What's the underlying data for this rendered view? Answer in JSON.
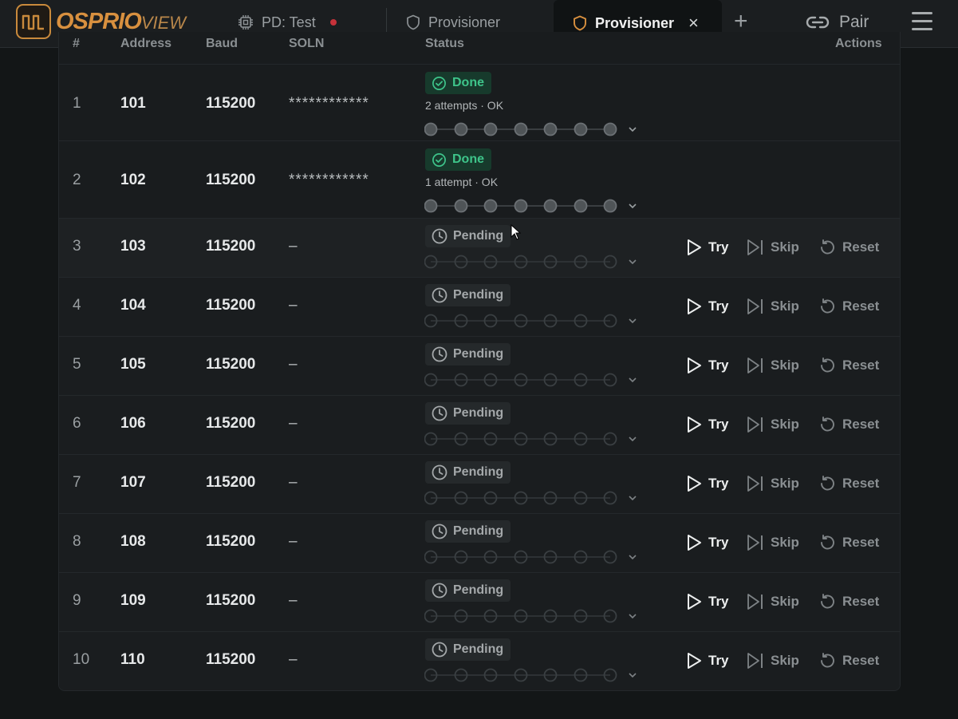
{
  "app": {
    "logo_main": "OSPRIO",
    "logo_sub": "VIEW"
  },
  "tabs": [
    {
      "label": "PD: Test",
      "icon": "chip-icon",
      "status_color": "#c6323a"
    },
    {
      "label": "Provisioner",
      "icon": "shield-icon"
    },
    {
      "label": "Provisioner",
      "icon": "shield-icon",
      "active": true,
      "close": "×"
    }
  ],
  "toolbar": {
    "add_tab": "+",
    "pair_label": "Pair"
  },
  "table": {
    "columns": [
      "#",
      "Address",
      "Baud",
      "SOLN",
      "Status",
      "Actions"
    ],
    "rows": [
      {
        "num": "1",
        "address": "101",
        "baud": "115200",
        "secret": "************",
        "status": "Done",
        "attempts": "2 attempts · OK",
        "steps_done": 7,
        "steps_total": 7
      },
      {
        "num": "2",
        "address": "102",
        "baud": "115200",
        "secret": "************",
        "status": "Done",
        "attempts": "1 attempt · OK",
        "steps_done": 7,
        "steps_total": 7
      },
      {
        "num": "3",
        "address": "103",
        "baud": "115200",
        "secret": "–",
        "status": "Pending",
        "steps_done": 0,
        "steps_total": 7,
        "actions": [
          "Try",
          "Skip",
          "Reset"
        ]
      },
      {
        "num": "4",
        "address": "104",
        "baud": "115200",
        "secret": "–",
        "status": "Pending",
        "steps_done": 0,
        "steps_total": 7,
        "actions": [
          "Try",
          "Skip",
          "Reset"
        ]
      },
      {
        "num": "5",
        "address": "105",
        "baud": "115200",
        "secret": "–",
        "status": "Pending",
        "steps_done": 0,
        "steps_total": 7,
        "actions": [
          "Try",
          "Skip",
          "Reset"
        ]
      },
      {
        "num": "6",
        "address": "106",
        "baud": "115200",
        "secret": "–",
        "status": "Pending",
        "steps_done": 0,
        "steps_total": 7,
        "actions": [
          "Try",
          "Skip",
          "Reset"
        ]
      },
      {
        "num": "7",
        "address": "107",
        "baud": "115200",
        "secret": "–",
        "status": "Pending",
        "steps_done": 0,
        "steps_total": 7,
        "actions": [
          "Try",
          "Skip",
          "Reset"
        ]
      },
      {
        "num": "8",
        "address": "108",
        "baud": "115200",
        "secret": "–",
        "status": "Pending",
        "steps_done": 0,
        "steps_total": 7,
        "actions": [
          "Try",
          "Skip",
          "Reset"
        ]
      },
      {
        "num": "9",
        "address": "109",
        "baud": "115200",
        "secret": "–",
        "status": "Pending",
        "steps_done": 0,
        "steps_total": 7,
        "actions": [
          "Try",
          "Skip",
          "Reset"
        ]
      },
      {
        "num": "10",
        "address": "110",
        "baud": "115200",
        "secret": "–",
        "status": "Pending",
        "steps_done": 0,
        "steps_total": 7,
        "actions": [
          "Try",
          "Skip",
          "Reset"
        ]
      }
    ]
  },
  "colors": {
    "accent": "#d8903f",
    "done": "#3ec48a",
    "recording": "#c6323a"
  }
}
